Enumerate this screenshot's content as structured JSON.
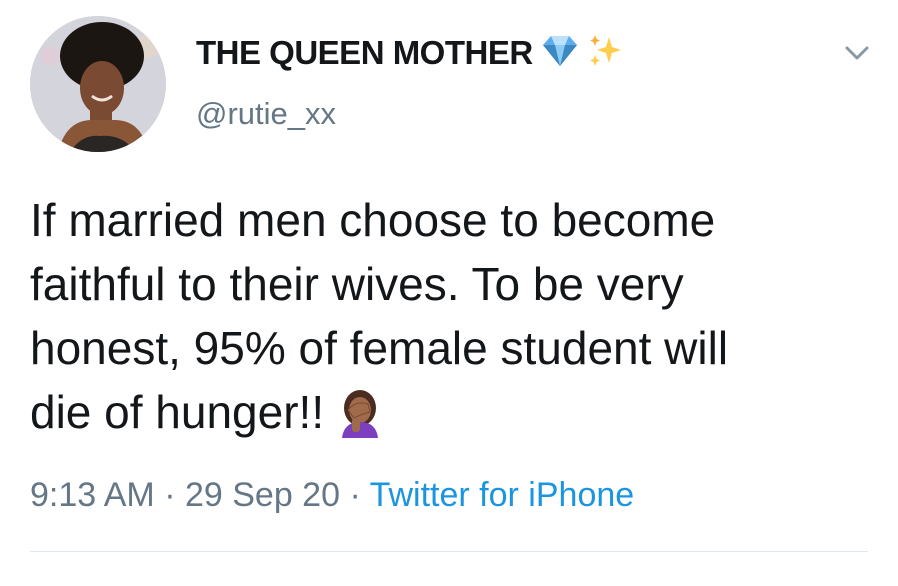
{
  "tweet": {
    "display_name": "THE QUEEN MOTHER",
    "handle": "@rutie_xx",
    "name_icons": [
      "gem-icon",
      "sparkles-icon"
    ],
    "text_lines": [
      "If married men choose to become",
      "faithful to their wives. To be very",
      "honest, 95% of female student will",
      "die of hunger!!"
    ],
    "trailing_emoji": "facepalm-icon",
    "time": "9:13 AM",
    "separator": " · ",
    "date": "29 Sep 20",
    "source": "Twitter for iPhone"
  },
  "colors": {
    "text": "#14171a",
    "secondary": "#657786",
    "link": "#1b95e0",
    "divider": "#e1e8ed"
  }
}
